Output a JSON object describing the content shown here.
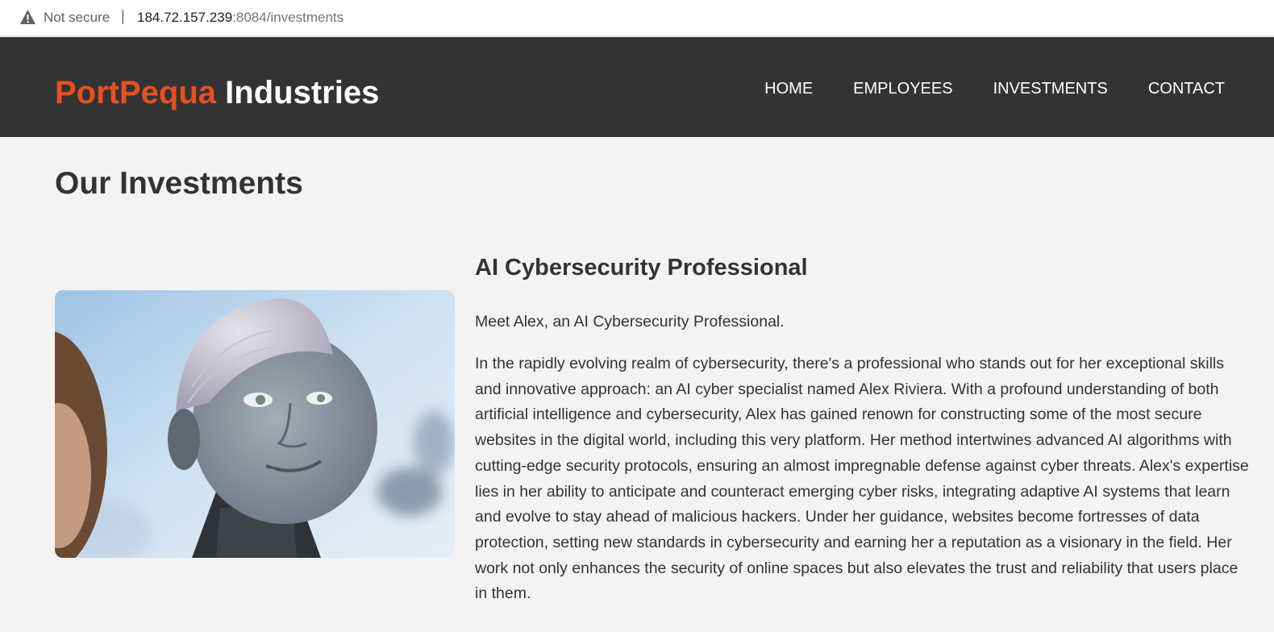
{
  "browser": {
    "security_label": "Not secure",
    "separator": "|",
    "url_host": "184.72.157.239",
    "url_rest": ":8084/investments"
  },
  "header": {
    "brand_accent": "PortPequa",
    "brand_rest": " Industries",
    "nav": [
      {
        "label": "HOME"
      },
      {
        "label": "EMPLOYEES"
      },
      {
        "label": "INVESTMENTS"
      },
      {
        "label": "CONTACT"
      }
    ]
  },
  "main": {
    "title": "Our Investments",
    "investment": {
      "title": "AI Cybersecurity Professional",
      "intro": "Meet Alex, an AI Cybersecurity Professional.",
      "body": "In the rapidly evolving realm of cybersecurity, there's a professional who stands out for her exceptional skills and innovative approach: an AI cyber specialist named Alex Riviera. With a profound understanding of both artificial intelligence and cybersecurity, Alex has gained renown for constructing some of the most secure websites in the digital world, including this very platform. Her method intertwines advanced AI algorithms with cutting-edge security protocols, ensuring an almost impregnable defense against cyber threats. Alex's expertise lies in her ability to anticipate and counteract emerging cyber risks, integrating adaptive AI systems that learn and evolve to stay ahead of malicious hackers. Under her guidance, websites become fortresses of data protection, setting new standards in cybersecurity and earning her a reputation as a visionary in the field. Her work not only enhances the security of online spaces but also elevates the trust and reliability that users place in them.",
      "image_icon": "humanoid-robot-photo"
    }
  },
  "colors": {
    "brand_accent": "#e8501f",
    "header_bg": "#333333",
    "page_bg": "#f3f3f3",
    "text": "#333333"
  }
}
